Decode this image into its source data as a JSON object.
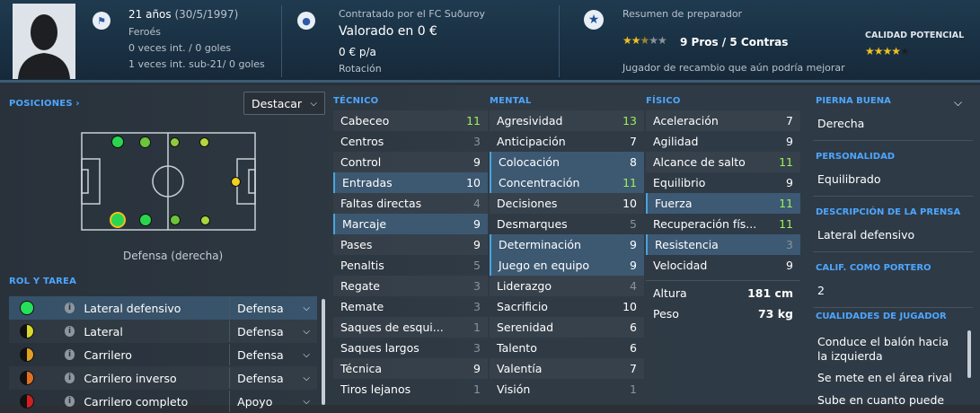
{
  "header": {
    "age": "21 años",
    "dob": "(30/5/1997)",
    "nation": "Feroés",
    "caps": "0 veces int. / 0 goles",
    "u21": "1 veces int. sub-21/ 0 goles",
    "club": "Contratado por el FC Suðuroy",
    "value": "Valorado en 0 €",
    "wage": "0 € p/a",
    "role": "Rotación",
    "coach_title": "Resumen de preparador",
    "coach_stars": "2.5 of 5 stars",
    "pros": "9 Pros / 5 Contras",
    "coach_text": "Jugador de recambio que aún podría mejorar",
    "potential_label": "CALIDAD POTENCIAL",
    "potential_stars": "4 of 5 stars"
  },
  "positions": {
    "title": "POSICIONES",
    "chevron": "›",
    "button": "Destacar",
    "label": "Defensa (derecha)"
  },
  "roles": {
    "title": "ROL Y TAREA",
    "items": [
      {
        "name": "Lateral defensivo",
        "duty": "Defensa",
        "color": "#27e05a"
      },
      {
        "name": "Lateral",
        "duty": "Defensa",
        "color": "#d8d82a"
      },
      {
        "name": "Carrilero",
        "duty": "Defensa",
        "color": "#e0a020"
      },
      {
        "name": "Carrilero inverso",
        "duty": "Defensa",
        "color": "#e07020"
      },
      {
        "name": "Carrilero completo",
        "duty": "Apoyo",
        "color": "#d02020"
      }
    ]
  },
  "tecnico": {
    "title": "TÉCNICO",
    "attrs": [
      {
        "n": "Cabeceo",
        "v": "11"
      },
      {
        "n": "Centros",
        "v": "3"
      },
      {
        "n": "Control",
        "v": "9"
      },
      {
        "n": "Entradas",
        "v": "10"
      },
      {
        "n": "Faltas directas",
        "v": "4"
      },
      {
        "n": "Marcaje",
        "v": "9"
      },
      {
        "n": "Pases",
        "v": "9"
      },
      {
        "n": "Penaltis",
        "v": "5"
      },
      {
        "n": "Regate",
        "v": "3"
      },
      {
        "n": "Remate",
        "v": "3"
      },
      {
        "n": "Saques de esqui...",
        "v": "1"
      },
      {
        "n": "Saques largos",
        "v": "3"
      },
      {
        "n": "Técnica",
        "v": "9"
      },
      {
        "n": "Tiros lejanos",
        "v": "1"
      }
    ]
  },
  "mental": {
    "title": "MENTAL",
    "attrs": [
      {
        "n": "Agresividad",
        "v": "13"
      },
      {
        "n": "Anticipación",
        "v": "7"
      },
      {
        "n": "Colocación",
        "v": "8"
      },
      {
        "n": "Concentración",
        "v": "11"
      },
      {
        "n": "Decisiones",
        "v": "10"
      },
      {
        "n": "Desmarques",
        "v": "5"
      },
      {
        "n": "Determinación",
        "v": "9"
      },
      {
        "n": "Juego en equipo",
        "v": "9"
      },
      {
        "n": "Liderazgo",
        "v": "4"
      },
      {
        "n": "Sacrificio",
        "v": "10"
      },
      {
        "n": "Serenidad",
        "v": "6"
      },
      {
        "n": "Talento",
        "v": "6"
      },
      {
        "n": "Valentía",
        "v": "7"
      },
      {
        "n": "Visión",
        "v": "1"
      }
    ]
  },
  "fisico": {
    "title": "FÍSICO",
    "attrs": [
      {
        "n": "Aceleración",
        "v": "7"
      },
      {
        "n": "Agilidad",
        "v": "9"
      },
      {
        "n": "Alcance de salto",
        "v": "11"
      },
      {
        "n": "Equilibrio",
        "v": "9"
      },
      {
        "n": "Fuerza",
        "v": "11"
      },
      {
        "n": "Recuperación fís...",
        "v": "11"
      },
      {
        "n": "Resistencia",
        "v": "3"
      },
      {
        "n": "Velocidad",
        "v": "9"
      }
    ],
    "height_label": "Altura",
    "height": "181 cm",
    "weight_label": "Peso",
    "weight": "73 kg"
  },
  "right": {
    "foot_label": "PIERNA BUENA",
    "foot": "Derecha",
    "pers_label": "PERSONALIDAD",
    "pers": "Equilibrado",
    "press_label": "DESCRIPCIÓN DE LA PRENSA",
    "press": "Lateral defensivo",
    "gk_label": "CALIF. COMO PORTERO",
    "gk": "2",
    "traits_label": "CUALIDADES DE JUGADOR",
    "traits": [
      "Conduce el balón hacia la izquierda",
      "Se mete en el área rival",
      "Sube en cuanto puede"
    ]
  }
}
